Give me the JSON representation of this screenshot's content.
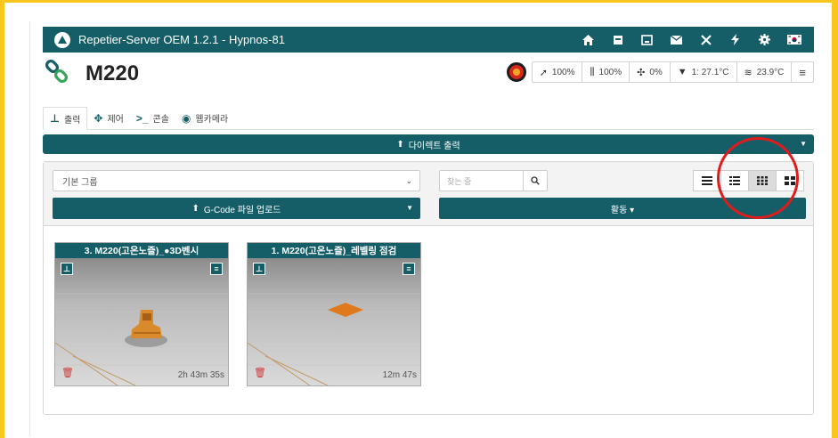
{
  "topbar": {
    "title": "Repetier-Server OEM 1.2.1 - Hypnos-81",
    "icons": [
      "home-icon",
      "calendar-icon",
      "print-icon",
      "mail-icon",
      "fullscreen-icon",
      "power-icon",
      "gear-icon",
      "flag-icon"
    ]
  },
  "printer": {
    "name": "M220"
  },
  "status": {
    "speed": "100%",
    "flow": "100%",
    "fan": "0%",
    "extruder": "1: 27.1°C",
    "bed": "23.9°C"
  },
  "tabs": [
    {
      "label": "출력",
      "icon": "print-icon"
    },
    {
      "label": "제어",
      "icon": "move-icon"
    },
    {
      "label": "콘솔",
      "icon": "terminal-icon"
    },
    {
      "label": "웹카메라",
      "icon": "webcam-icon"
    }
  ],
  "direct_print": {
    "label": "다이렉트 출력"
  },
  "filters": {
    "group": "기본 그룹",
    "search_placeholder": "찾는 중"
  },
  "upload": {
    "label": "G-Code 파일 업로드"
  },
  "activity": {
    "label": "활동 ▾"
  },
  "jobs": [
    {
      "title": "3. M220(고온노즐)_●3D벤시",
      "duration": "2h 43m 35s"
    },
    {
      "title": "1. M220(고온노즐)_레벨링 점검",
      "duration": "12m 47s"
    }
  ],
  "colors": {
    "primary": "#155e67",
    "frame": "#f7c71d",
    "highlight": "#e01b1b",
    "model": "#d98a2b"
  }
}
